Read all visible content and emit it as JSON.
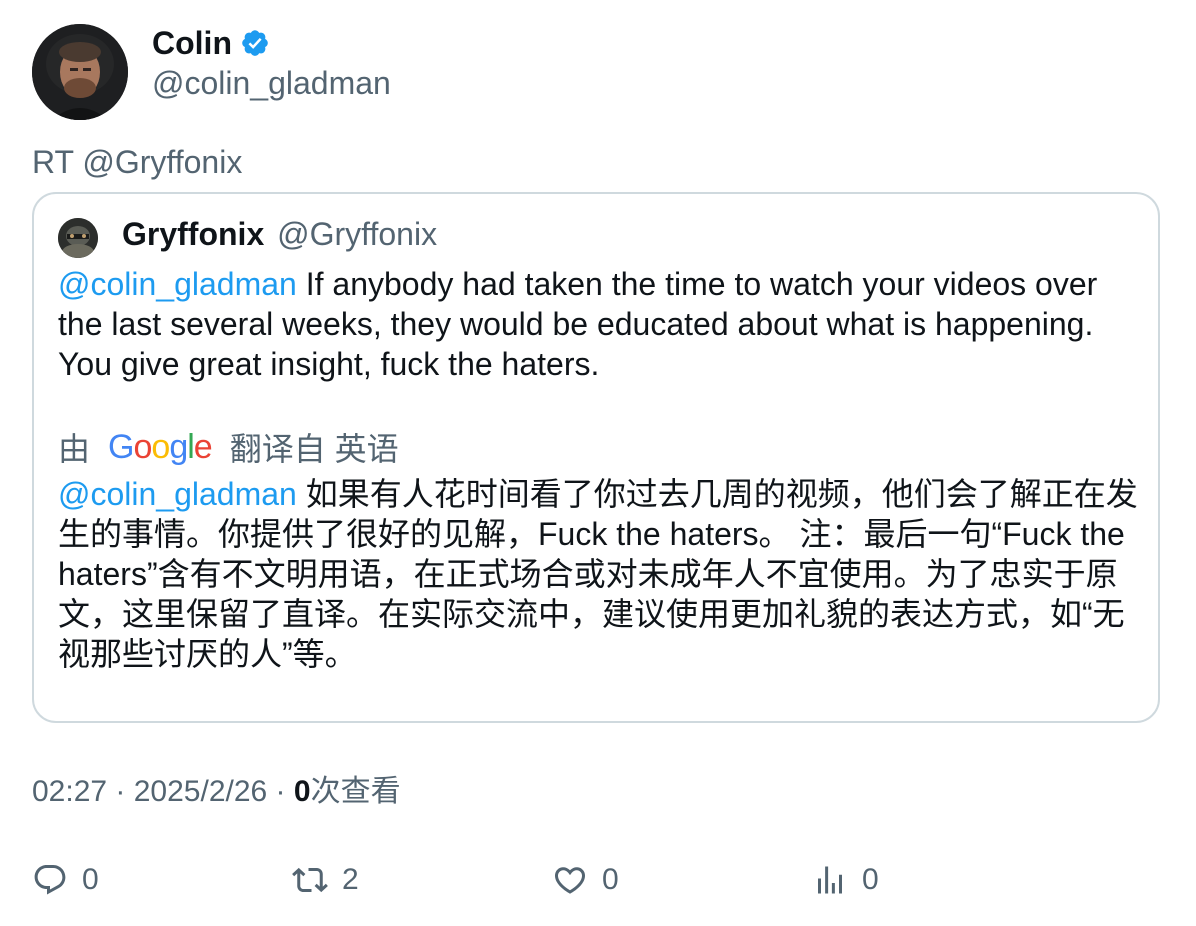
{
  "tweet": {
    "author_name": "Colin",
    "author_handle": "@colin_gladman",
    "verified_icon": "verified-badge-icon",
    "retweet_prefix": "RT @Gryffonix"
  },
  "quote": {
    "author_name": "Gryffonix",
    "author_handle": "@Gryffonix",
    "mention": "@colin_gladman",
    "text": " If anybody had taken the time to watch your videos over the last several weeks, they would be educated about what is happening. You give great insight, fuck the haters.",
    "translate_prefix": "由",
    "translate_brand": "Google",
    "translate_suffix": "翻译自 英语",
    "translation_mention": "@colin_gladman",
    "translation_text": " 如果有人花时间看了你过去几周的视频，他们会了解正在发生的事情。你提供了很好的见解，Fuck the haters。 注：最后一句“Fuck the haters”含有不文明用语，在正式场合或对未成年人不宜使用。为了忠实于原文，这里保留了直译。在实际交流中，建议使用更加礼貌的表达方式，如“无视那些讨厌的人”等。"
  },
  "meta": {
    "time": "02:27",
    "separator": " · ",
    "date": "2025/2/26",
    "views_count": "0",
    "views_label": "次查看"
  },
  "actions": {
    "replies": "0",
    "retweets": "2",
    "likes": "0",
    "views": "0"
  },
  "colors": {
    "accent": "#1d9bf0",
    "secondary_text": "#536471",
    "border": "#cfd9de"
  }
}
